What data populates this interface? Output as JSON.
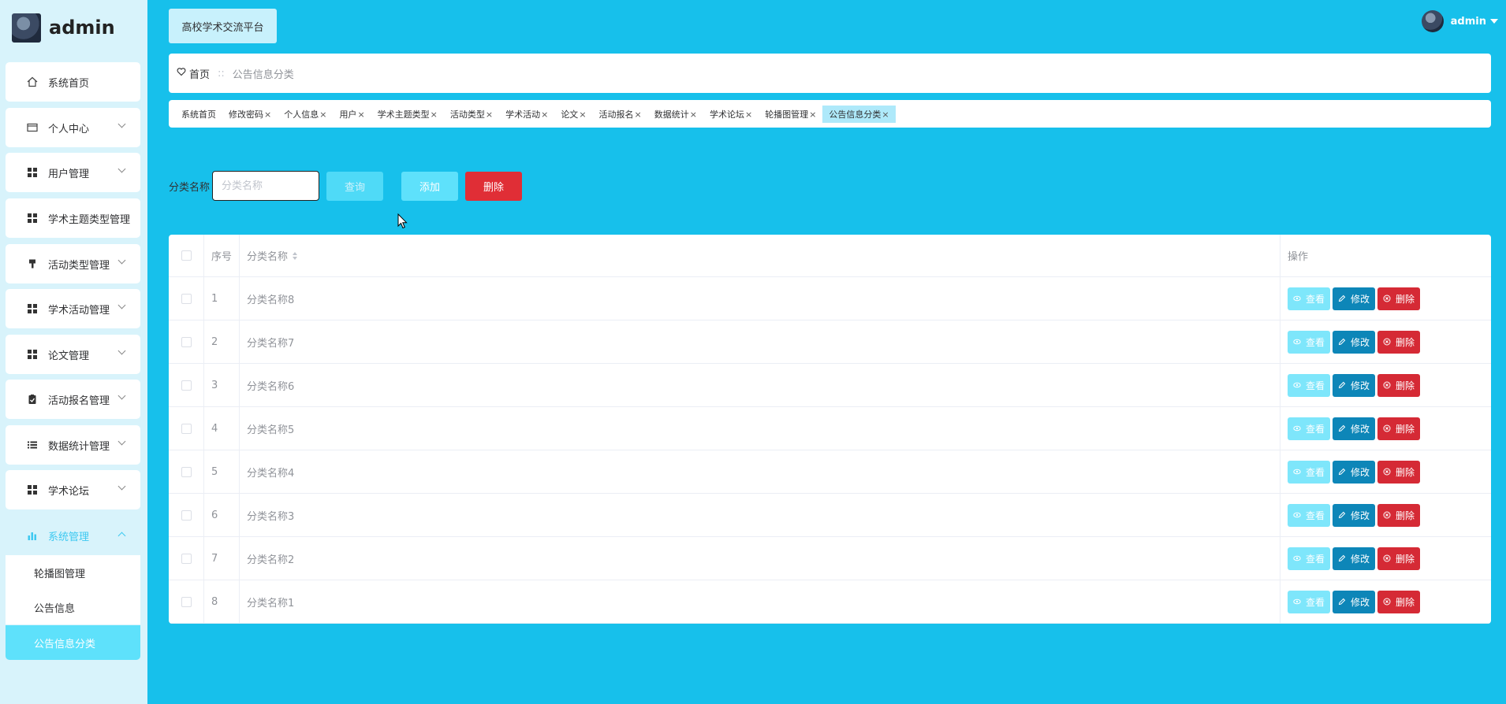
{
  "app": {
    "brand_name": "admin",
    "platform_title": "高校学术交流平台",
    "user_name": "admin"
  },
  "sidebar": {
    "items": [
      {
        "label": "系统首页",
        "icon": "home-icon"
      },
      {
        "label": "个人中心",
        "icon": "id-card-icon"
      },
      {
        "label": "用户管理",
        "icon": "grid-icon"
      },
      {
        "label": "学术主题类型管理",
        "icon": "grid-icon"
      },
      {
        "label": "活动类型管理",
        "icon": "brush-icon"
      },
      {
        "label": "学术活动管理",
        "icon": "grid-icon"
      },
      {
        "label": "论文管理",
        "icon": "grid-icon"
      },
      {
        "label": "活动报名管理",
        "icon": "clipboard-icon"
      },
      {
        "label": "数据统计管理",
        "icon": "list-icon"
      },
      {
        "label": "学术论坛",
        "icon": "grid-icon"
      },
      {
        "label": "系统管理",
        "icon": "bar-chart-icon"
      }
    ],
    "sub_items": [
      {
        "label": "轮播图管理"
      },
      {
        "label": "公告信息"
      },
      {
        "label": "公告信息分类"
      }
    ]
  },
  "breadcrumb": {
    "home": "首页",
    "separator": "::",
    "current": "公告信息分类"
  },
  "tags": [
    {
      "label": "系统首页",
      "closable": false
    },
    {
      "label": "修改密码",
      "closable": true
    },
    {
      "label": "个人信息",
      "closable": true
    },
    {
      "label": "用户",
      "closable": true
    },
    {
      "label": "学术主题类型",
      "closable": true
    },
    {
      "label": "活动类型",
      "closable": true
    },
    {
      "label": "学术活动",
      "closable": true
    },
    {
      "label": "论文",
      "closable": true
    },
    {
      "label": "活动报名",
      "closable": true
    },
    {
      "label": "数据统计",
      "closable": true
    },
    {
      "label": "学术论坛",
      "closable": true
    },
    {
      "label": "轮播图管理",
      "closable": true
    },
    {
      "label": "公告信息分类",
      "closable": true
    }
  ],
  "search": {
    "label": "分类名称",
    "placeholder": "分类名称",
    "query_label": "查询",
    "add_label": "添加",
    "delete_label": "删除"
  },
  "table": {
    "headers": {
      "index": "序号",
      "name": "分类名称",
      "ops": "操作"
    },
    "rows": [
      {
        "index": "1",
        "name": "分类名称8"
      },
      {
        "index": "2",
        "name": "分类名称7"
      },
      {
        "index": "3",
        "name": "分类名称6"
      },
      {
        "index": "4",
        "name": "分类名称5"
      },
      {
        "index": "5",
        "name": "分类名称4"
      },
      {
        "index": "6",
        "name": "分类名称3"
      },
      {
        "index": "7",
        "name": "分类名称2"
      },
      {
        "index": "8",
        "name": "分类名称1"
      }
    ],
    "op_labels": {
      "view": "查看",
      "edit": "修改",
      "delete": "删除"
    }
  },
  "colors": {
    "background": "#17c0eb",
    "accent": "#5ee1fb",
    "edit": "#0d86b8",
    "danger": "#e02e36"
  }
}
